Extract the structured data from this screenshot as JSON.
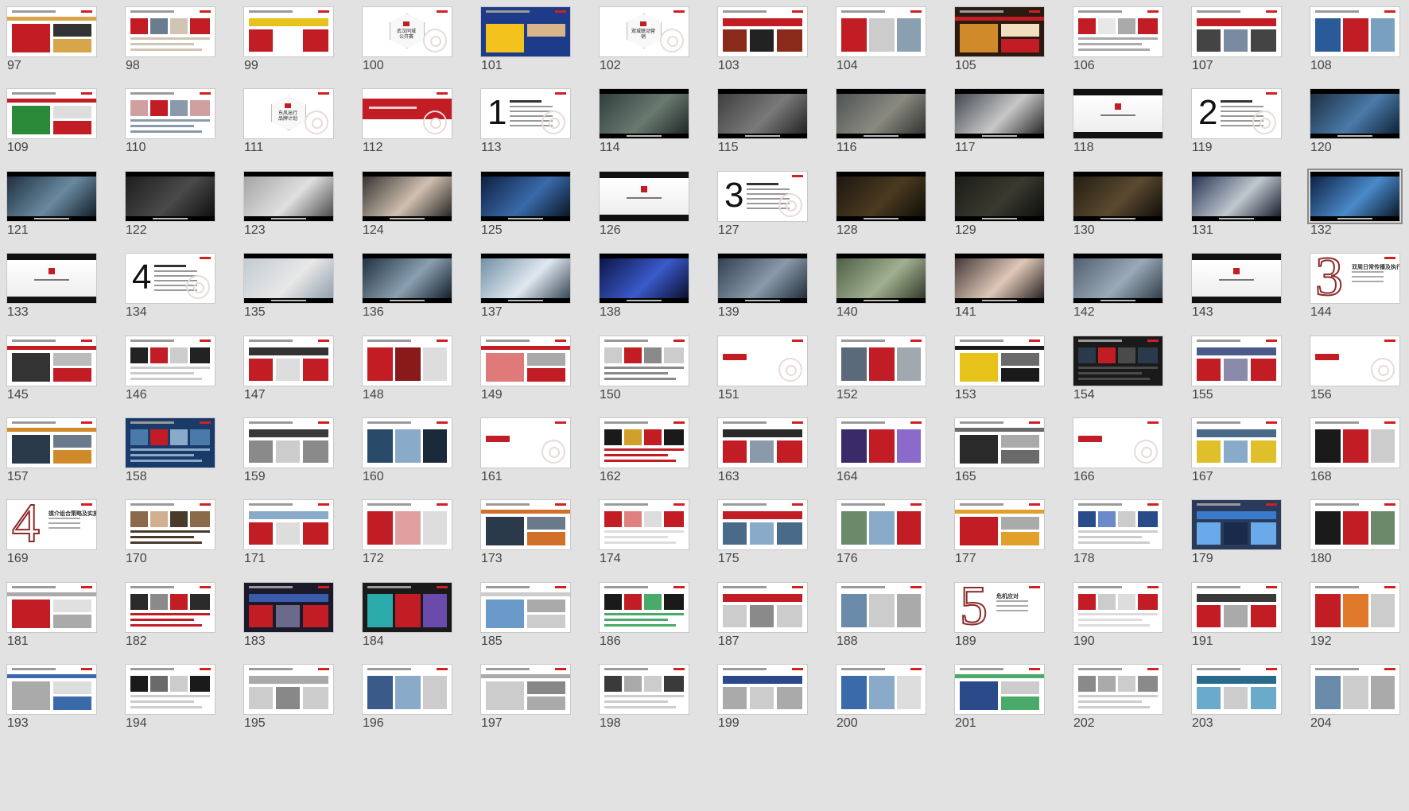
{
  "window": {
    "background": "#e2e2e2"
  },
  "slides": [
    {
      "n": "97",
      "kind": "grid",
      "bg": "#ffffff",
      "accents": [
        "#c21c24",
        "#d9a54a",
        "#333333"
      ]
    },
    {
      "n": "98",
      "kind": "grid",
      "bg": "#ffffff",
      "accents": [
        "#c21c24",
        "#6b7c8e",
        "#d0c4b4"
      ]
    },
    {
      "n": "99",
      "kind": "grid",
      "bg": "#ffffff",
      "accents": [
        "#e7c21a",
        "#c21c24",
        "#ffffff"
      ]
    },
    {
      "n": "100",
      "kind": "badge",
      "text": "武汉同城 公开赛"
    },
    {
      "n": "101",
      "kind": "grid",
      "bg": "#1e3b8a",
      "accents": [
        "#f4c21c",
        "#1e3b8a",
        "#d9b58a"
      ]
    },
    {
      "n": "102",
      "kind": "badge",
      "text": "双城联动营销"
    },
    {
      "n": "103",
      "kind": "grid",
      "bg": "#ffffff",
      "accents": [
        "#c21c24",
        "#8a2a1a",
        "#222222"
      ]
    },
    {
      "n": "104",
      "kind": "grid",
      "bg": "#ffffff",
      "accents": [
        "#c21c24",
        "#cccccc",
        "#8aa0b0"
      ]
    },
    {
      "n": "105",
      "kind": "grid",
      "bg": "#2a1a10",
      "accents": [
        "#d08a2a",
        "#c21c24",
        "#f0e0c0"
      ]
    },
    {
      "n": "106",
      "kind": "grid",
      "bg": "#ffffff",
      "accents": [
        "#c21c24",
        "#e8e8e8",
        "#aaaaaa"
      ]
    },
    {
      "n": "107",
      "kind": "grid",
      "bg": "#ffffff",
      "accents": [
        "#c21c24",
        "#444444",
        "#7a8aa0"
      ]
    },
    {
      "n": "108",
      "kind": "grid",
      "bg": "#ffffff",
      "accents": [
        "#2a5a9a",
        "#c21c24",
        "#7aa0c0"
      ]
    },
    {
      "n": "109",
      "kind": "grid",
      "bg": "#ffffff",
      "accents": [
        "#2a8a3a",
        "#c21c24",
        "#dddddd"
      ]
    },
    {
      "n": "110",
      "kind": "grid",
      "bg": "#ffffff",
      "accents": [
        "#d0a0a0",
        "#c21c24",
        "#8a9aaa"
      ]
    },
    {
      "n": "111",
      "kind": "badge",
      "text": "东风出行 品牌计划"
    },
    {
      "n": "112",
      "kind": "redband",
      "text": ""
    },
    {
      "n": "113",
      "kind": "bignum",
      "text": "1"
    },
    {
      "n": "114",
      "kind": "photo",
      "accents": [
        "#2a3a3a",
        "#6a7a70",
        "#1a2020"
      ]
    },
    {
      "n": "115",
      "kind": "photo",
      "accents": [
        "#3a3a3a",
        "#7a7a7a",
        "#1a1a1a"
      ]
    },
    {
      "n": "116",
      "kind": "photo",
      "accents": [
        "#4a5050",
        "#8a8a80",
        "#2a2a2a"
      ]
    },
    {
      "n": "117",
      "kind": "photo",
      "accents": [
        "#3a4048",
        "#c8c8c8",
        "#1a1a1a"
      ]
    },
    {
      "n": "118",
      "kind": "dark",
      "text": ""
    },
    {
      "n": "119",
      "kind": "bignum",
      "text": "2"
    },
    {
      "n": "120",
      "kind": "photo",
      "accents": [
        "#1a2a3a",
        "#4a7aaa",
        "#0a1a2a"
      ]
    },
    {
      "n": "121",
      "kind": "photo",
      "accents": [
        "#1a2a3a",
        "#6a8aa0",
        "#0a1520"
      ]
    },
    {
      "n": "122",
      "kind": "photo",
      "accents": [
        "#1a1a1a",
        "#4a4a4a",
        "#0a0a0a"
      ]
    },
    {
      "n": "123",
      "kind": "photo",
      "accents": [
        "#a0a0a0",
        "#e0e0e0",
        "#404040"
      ]
    },
    {
      "n": "124",
      "kind": "photo",
      "accents": [
        "#2a2a2a",
        "#d0c0b0",
        "#1a1a1a"
      ]
    },
    {
      "n": "125",
      "kind": "photo",
      "accents": [
        "#0a1a3a",
        "#3a6aaa",
        "#05101a"
      ]
    },
    {
      "n": "126",
      "kind": "dark",
      "text": ""
    },
    {
      "n": "127",
      "kind": "bignum",
      "text": "3"
    },
    {
      "n": "128",
      "kind": "photo",
      "accents": [
        "#1a1510",
        "#4a3a20",
        "#0a0a05"
      ]
    },
    {
      "n": "129",
      "kind": "photo",
      "accents": [
        "#1a1a15",
        "#3a3a30",
        "#0a0a0a"
      ]
    },
    {
      "n": "130",
      "kind": "photo",
      "accents": [
        "#201a10",
        "#5a4a30",
        "#0a0805"
      ]
    },
    {
      "n": "131",
      "kind": "photo",
      "accents": [
        "#1a2a4a",
        "#c0c8d0",
        "#0a1020"
      ]
    },
    {
      "n": "132",
      "kind": "photo",
      "accents": [
        "#0a1a3a",
        "#4a8aca",
        "#05101a"
      ],
      "selected": true
    },
    {
      "n": "133",
      "kind": "dark",
      "text": ""
    },
    {
      "n": "134",
      "kind": "bignum",
      "text": "4"
    },
    {
      "n": "135",
      "kind": "photo",
      "accents": [
        "#c0c8d0",
        "#e8e8e8",
        "#8a9aaa"
      ]
    },
    {
      "n": "136",
      "kind": "photo",
      "accents": [
        "#1a2a3a",
        "#8aa0b0",
        "#0a1520"
      ]
    },
    {
      "n": "137",
      "kind": "photo",
      "accents": [
        "#6a8aa0",
        "#e0e8f0",
        "#2a3a4a"
      ]
    },
    {
      "n": "138",
      "kind": "photo",
      "accents": [
        "#0a1040",
        "#3a5aca",
        "#050a20"
      ]
    },
    {
      "n": "139",
      "kind": "photo",
      "accents": [
        "#2a3a4a",
        "#8a9aaa",
        "#1a2530"
      ]
    },
    {
      "n": "140",
      "kind": "photo",
      "accents": [
        "#4a5a40",
        "#a0b090",
        "#2a3020"
      ]
    },
    {
      "n": "141",
      "kind": "photo",
      "accents": [
        "#3a3030",
        "#e0c8b8",
        "#1a1515"
      ]
    },
    {
      "n": "142",
      "kind": "photo",
      "accents": [
        "#4a5a6a",
        "#9aaab8",
        "#2a3540"
      ]
    },
    {
      "n": "143",
      "kind": "dark",
      "text": ""
    },
    {
      "n": "144",
      "kind": "outline",
      "text": "3",
      "label": "双周日常传播及执行"
    },
    {
      "n": "145",
      "kind": "grid",
      "bg": "#ffffff",
      "accents": [
        "#333333",
        "#c21c24",
        "#bbbbbb"
      ]
    },
    {
      "n": "146",
      "kind": "grid",
      "bg": "#ffffff",
      "accents": [
        "#222222",
        "#c21c24",
        "#cccccc"
      ]
    },
    {
      "n": "147",
      "kind": "grid",
      "bg": "#ffffff",
      "accents": [
        "#333333",
        "#c21c24",
        "#dddddd"
      ]
    },
    {
      "n": "148",
      "kind": "grid",
      "bg": "#ffffff",
      "accents": [
        "#c21c24",
        "#8a1a1a",
        "#dddddd"
      ]
    },
    {
      "n": "149",
      "kind": "grid",
      "bg": "#ffffff",
      "accents": [
        "#e07a7a",
        "#c21c24",
        "#aaaaaa"
      ]
    },
    {
      "n": "150",
      "kind": "grid",
      "bg": "#ffffff",
      "accents": [
        "#cccccc",
        "#c21c24",
        "#8a8a8a"
      ]
    },
    {
      "n": "151",
      "kind": "pill",
      "text": ""
    },
    {
      "n": "152",
      "kind": "grid",
      "bg": "#ffffff",
      "accents": [
        "#5a6a7a",
        "#c21c24",
        "#a0a8b0"
      ]
    },
    {
      "n": "153",
      "kind": "grid",
      "bg": "#ffffff",
      "accents": [
        "#e7c21a",
        "#1a1a1a",
        "#6a6a6a"
      ]
    },
    {
      "n": "154",
      "kind": "grid",
      "bg": "#1a1a1a",
      "accents": [
        "#2a3a4a",
        "#c21c24",
        "#4a4a4a"
      ]
    },
    {
      "n": "155",
      "kind": "grid",
      "bg": "#ffffff",
      "accents": [
        "#4a5a8a",
        "#c21c24",
        "#8a8aaa"
      ]
    },
    {
      "n": "156",
      "kind": "pill",
      "text": ""
    },
    {
      "n": "157",
      "kind": "grid",
      "bg": "#ffffff",
      "accents": [
        "#2a3a4a",
        "#d08a2a",
        "#6a7a8a"
      ]
    },
    {
      "n": "158",
      "kind": "grid",
      "bg": "#1a3a6a",
      "accents": [
        "#4a7aaa",
        "#c21c24",
        "#8aaaca"
      ]
    },
    {
      "n": "159",
      "kind": "grid",
      "bg": "#ffffff",
      "accents": [
        "#3a3a3a",
        "#8a8a8a",
        "#cccccc"
      ]
    },
    {
      "n": "160",
      "kind": "grid",
      "bg": "#ffffff",
      "accents": [
        "#2a4a6a",
        "#8aaaca",
        "#1a2a3a"
      ]
    },
    {
      "n": "161",
      "kind": "pill",
      "text": ""
    },
    {
      "n": "162",
      "kind": "grid",
      "bg": "#ffffff",
      "accents": [
        "#1a1a1a",
        "#d0a02a",
        "#c21c24"
      ]
    },
    {
      "n": "163",
      "kind": "grid",
      "bg": "#ffffff",
      "accents": [
        "#2a2a2a",
        "#c21c24",
        "#8a9aaa"
      ]
    },
    {
      "n": "164",
      "kind": "grid",
      "bg": "#ffffff",
      "accents": [
        "#3a2a6a",
        "#c21c24",
        "#8a6aca"
      ]
    },
    {
      "n": "165",
      "kind": "grid",
      "bg": "#ffffff",
      "accents": [
        "#2a2a2a",
        "#6a6a6a",
        "#aaaaaa"
      ]
    },
    {
      "n": "166",
      "kind": "pill",
      "text": ""
    },
    {
      "n": "167",
      "kind": "grid",
      "bg": "#ffffff",
      "accents": [
        "#4a6a8a",
        "#e0c02a",
        "#8aaaca"
      ]
    },
    {
      "n": "168",
      "kind": "grid",
      "bg": "#ffffff",
      "accents": [
        "#1a1a1a",
        "#c21c24",
        "#cccccc"
      ]
    },
    {
      "n": "169",
      "kind": "outline",
      "text": "4",
      "label": "媒介组合策略及实施"
    },
    {
      "n": "170",
      "kind": "grid",
      "bg": "#ffffff",
      "accents": [
        "#8a6a4a",
        "#d0b090",
        "#4a3a2a"
      ]
    },
    {
      "n": "171",
      "kind": "grid",
      "bg": "#ffffff",
      "accents": [
        "#8aaaca",
        "#c21c24",
        "#dddddd"
      ]
    },
    {
      "n": "172",
      "kind": "grid",
      "bg": "#ffffff",
      "accents": [
        "#c21c24",
        "#e0a0a0",
        "#dddddd"
      ]
    },
    {
      "n": "173",
      "kind": "grid",
      "bg": "#ffffff",
      "accents": [
        "#2a3a4a",
        "#d0702a",
        "#6a7a8a"
      ]
    },
    {
      "n": "174",
      "kind": "grid",
      "bg": "#ffffff",
      "accents": [
        "#c21c24",
        "#e08080",
        "#dddddd"
      ]
    },
    {
      "n": "175",
      "kind": "grid",
      "bg": "#ffffff",
      "accents": [
        "#c21c24",
        "#4a6a8a",
        "#8aaaca"
      ]
    },
    {
      "n": "176",
      "kind": "grid",
      "bg": "#ffffff",
      "accents": [
        "#6a8a6a",
        "#8aaaca",
        "#c21c24"
      ]
    },
    {
      "n": "177",
      "kind": "grid",
      "bg": "#ffffff",
      "accents": [
        "#c21c24",
        "#e0a02a",
        "#aaaaaa"
      ]
    },
    {
      "n": "178",
      "kind": "grid",
      "bg": "#ffffff",
      "accents": [
        "#2a4a8a",
        "#6a8aca",
        "#cccccc"
      ]
    },
    {
      "n": "179",
      "kind": "grid",
      "bg": "#2a3a5a",
      "accents": [
        "#3a7aca",
        "#6aaaea",
        "#1a2a4a"
      ]
    },
    {
      "n": "180",
      "kind": "grid",
      "bg": "#ffffff",
      "accents": [
        "#1a1a1a",
        "#c21c24",
        "#6a8a6a"
      ]
    },
    {
      "n": "181",
      "kind": "grid",
      "bg": "#ffffff",
      "accents": [
        "#c21c24",
        "#aaaaaa",
        "#e0e0e0"
      ]
    },
    {
      "n": "182",
      "kind": "grid",
      "bg": "#ffffff",
      "accents": [
        "#2a2a2a",
        "#8a8a8a",
        "#c21c24"
      ]
    },
    {
      "n": "183",
      "kind": "grid",
      "bg": "#1a1a2a",
      "accents": [
        "#3a5aaa",
        "#c21c24",
        "#6a6a8a"
      ]
    },
    {
      "n": "184",
      "kind": "grid",
      "bg": "#1a1a1a",
      "accents": [
        "#2aaaaa",
        "#c21c24",
        "#6a4aaa"
      ]
    },
    {
      "n": "185",
      "kind": "grid",
      "bg": "#ffffff",
      "accents": [
        "#6a9aca",
        "#cccccc",
        "#aaaaaa"
      ]
    },
    {
      "n": "186",
      "kind": "grid",
      "bg": "#ffffff",
      "accents": [
        "#1a1a1a",
        "#c21c24",
        "#4aaa6a"
      ]
    },
    {
      "n": "187",
      "kind": "grid",
      "bg": "#ffffff",
      "accents": [
        "#c21c24",
        "#cccccc",
        "#8a8a8a"
      ]
    },
    {
      "n": "188",
      "kind": "grid",
      "bg": "#ffffff",
      "accents": [
        "#6a8aaa",
        "#cccccc",
        "#aaaaaa"
      ]
    },
    {
      "n": "189",
      "kind": "outline",
      "text": "5",
      "label": "危机应对"
    },
    {
      "n": "190",
      "kind": "grid",
      "bg": "#ffffff",
      "accents": [
        "#c21c24",
        "#cccccc",
        "#dddddd"
      ]
    },
    {
      "n": "191",
      "kind": "grid",
      "bg": "#ffffff",
      "accents": [
        "#3a3a3a",
        "#c21c24",
        "#aaaaaa"
      ]
    },
    {
      "n": "192",
      "kind": "grid",
      "bg": "#ffffff",
      "accents": [
        "#c21c24",
        "#e07a2a",
        "#cccccc"
      ]
    },
    {
      "n": "193",
      "kind": "grid",
      "bg": "#ffffff",
      "accents": [
        "#aaaaaa",
        "#3a6aaa",
        "#dddddd"
      ]
    },
    {
      "n": "194",
      "kind": "grid",
      "bg": "#ffffff",
      "accents": [
        "#1a1a1a",
        "#6a6a6a",
        "#cccccc"
      ]
    },
    {
      "n": "195",
      "kind": "grid",
      "bg": "#ffffff",
      "accents": [
        "#aaaaaa",
        "#cccccc",
        "#888888"
      ]
    },
    {
      "n": "196",
      "kind": "grid",
      "bg": "#ffffff",
      "accents": [
        "#3a5a8a",
        "#8aaaca",
        "#cccccc"
      ]
    },
    {
      "n": "197",
      "kind": "grid",
      "bg": "#ffffff",
      "accents": [
        "#cccccc",
        "#aaaaaa",
        "#888888"
      ]
    },
    {
      "n": "198",
      "kind": "grid",
      "bg": "#ffffff",
      "accents": [
        "#3a3a3a",
        "#aaaaaa",
        "#cccccc"
      ]
    },
    {
      "n": "199",
      "kind": "grid",
      "bg": "#ffffff",
      "accents": [
        "#2a4a8a",
        "#aaaaaa",
        "#cccccc"
      ]
    },
    {
      "n": "200",
      "kind": "grid",
      "bg": "#ffffff",
      "accents": [
        "#3a6aaa",
        "#8aaaca",
        "#dddddd"
      ]
    },
    {
      "n": "201",
      "kind": "grid",
      "bg": "#ffffff",
      "accents": [
        "#2a4a8a",
        "#4aaa6a",
        "#cccccc"
      ]
    },
    {
      "n": "202",
      "kind": "grid",
      "bg": "#ffffff",
      "accents": [
        "#8a8a8a",
        "#aaaaaa",
        "#cccccc"
      ]
    },
    {
      "n": "203",
      "kind": "grid",
      "bg": "#ffffff",
      "accents": [
        "#2a6a8a",
        "#6aaaca",
        "#cccccc"
      ]
    },
    {
      "n": "204",
      "kind": "grid",
      "bg": "#ffffff",
      "accents": [
        "#6a8aaa",
        "#cccccc",
        "#aaaaaa"
      ]
    }
  ]
}
